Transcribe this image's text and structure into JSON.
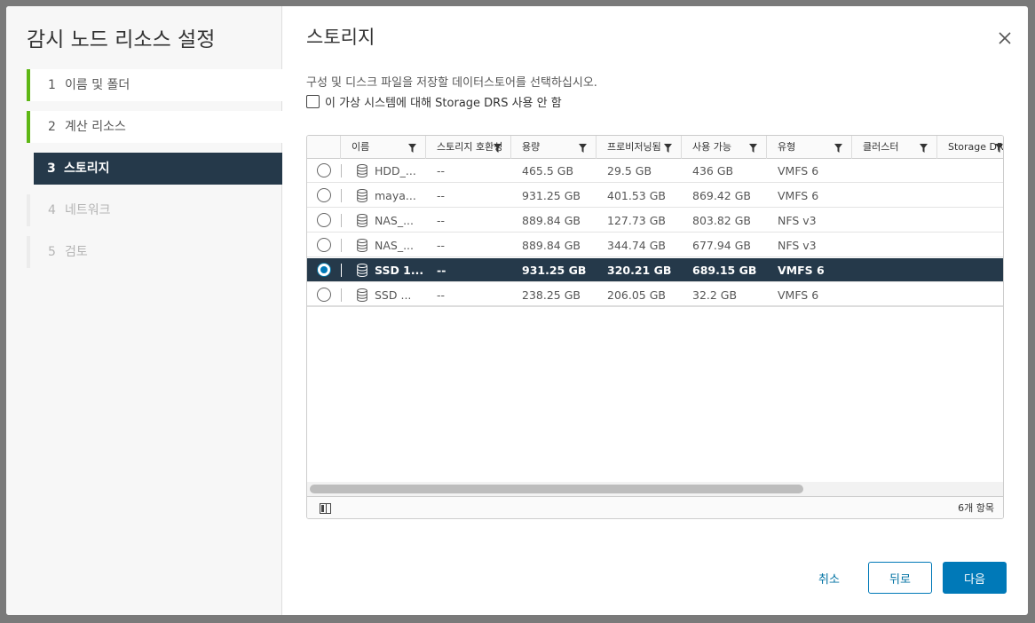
{
  "sidebar": {
    "title": "감시 노드 리소스 설정",
    "steps": [
      {
        "num": "1",
        "label": "이름 및 폴더",
        "state": "done"
      },
      {
        "num": "2",
        "label": "계산 리소스",
        "state": "done"
      },
      {
        "num": "3",
        "label": "스토리지",
        "state": "active"
      },
      {
        "num": "4",
        "label": "네트워크",
        "state": "disabled"
      },
      {
        "num": "5",
        "label": "검토",
        "state": "disabled"
      }
    ]
  },
  "main": {
    "title": "스토리지",
    "description": "구성 및 디스크 파일을 저장할 데이터스토어를 선택하십시오.",
    "checkbox_label": "이 가상 시스템에 대해 Storage DRS 사용 안 함",
    "checkbox_checked": false
  },
  "grid": {
    "columns": [
      "이름",
      "스토리지 호환성",
      "용량",
      "프로비저닝됨",
      "사용 가능",
      "유형",
      "클러스터",
      "Storage DRS"
    ],
    "rows": [
      {
        "name": "HDD_...",
        "compat": "--",
        "capacity": "465.5 GB",
        "provisioned": "29.5 GB",
        "free": "436 GB",
        "type": "VMFS 6",
        "cluster": "",
        "selected": false
      },
      {
        "name": "maya...",
        "compat": "--",
        "capacity": "931.25 GB",
        "provisioned": "401.53 GB",
        "free": "869.42 GB",
        "type": "VMFS 6",
        "cluster": "",
        "selected": false
      },
      {
        "name": "NAS_...",
        "compat": "--",
        "capacity": "889.84 GB",
        "provisioned": "127.73 GB",
        "free": "803.82 GB",
        "type": "NFS v3",
        "cluster": "",
        "selected": false
      },
      {
        "name": "NAS_...",
        "compat": "--",
        "capacity": "889.84 GB",
        "provisioned": "344.74 GB",
        "free": "677.94 GB",
        "type": "NFS v3",
        "cluster": "",
        "selected": false
      },
      {
        "name": "SSD 1...",
        "compat": "--",
        "capacity": "931.25 GB",
        "provisioned": "320.21 GB",
        "free": "689.15 GB",
        "type": "VMFS 6",
        "cluster": "",
        "selected": true
      },
      {
        "name": "SSD ...",
        "compat": "--",
        "capacity": "238.25 GB",
        "provisioned": "206.05 GB",
        "free": "32.2 GB",
        "type": "VMFS 6",
        "cluster": "",
        "selected": false
      }
    ],
    "count_label": "6개 항목"
  },
  "buttons": {
    "cancel": "취소",
    "back": "뒤로",
    "next": "다음"
  },
  "colors": {
    "accent": "#0079b8",
    "selected_row": "#25394a",
    "done_step": "#5eb715"
  }
}
